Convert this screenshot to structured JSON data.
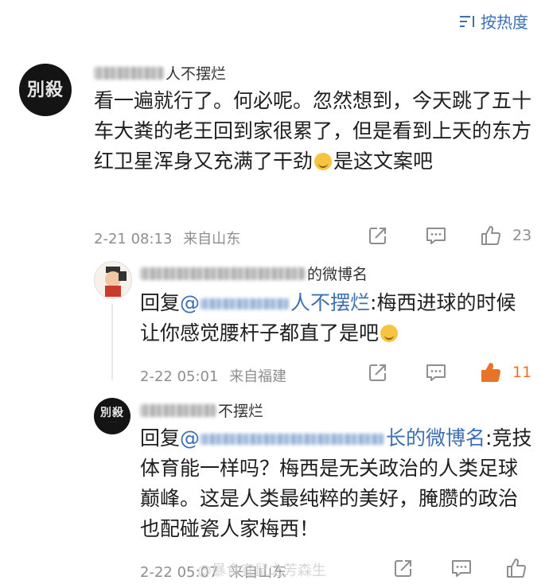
{
  "sort": {
    "label": "按热度",
    "icon": "sort-icon"
  },
  "comments": [
    {
      "avatar_text": "別殺",
      "name_suffix": "人不摆烂",
      "body": "看一遍就行了。何必呢。忽然想到，今天跳了五十车大粪的老王回到家很累了，但是看到上天的东方红卫星浑身又充满了干劲",
      "body_tail": "是这文案吧",
      "time": "2-21 08:13",
      "location": "来自山东",
      "likes": "23"
    },
    {
      "name_suffix": "的微博名",
      "reply_prefix": "回复",
      "mention": "@",
      "mention_suffix": "人不摆烂",
      "body": ":梅西进球的时候让你感觉腰杆子都直了是吧",
      "time": "2-22 05:01",
      "location": "来自福建",
      "likes": "11",
      "like_color": "#e8742a"
    },
    {
      "avatar_text": "別殺",
      "name_suffix": "不摆烂",
      "reply_prefix": "回复",
      "mention": "@",
      "mention_suffix": "长的微博名",
      "body": ":竞技体育能一样吗？梅西是无关政治的人类足球巅峰。这是人类最纯粹的美好，腌臜的政治也配碰瓷人家梅西！",
      "time": "2-22 05:07",
      "location": "来自山东"
    }
  ],
  "watermark": "@暴食宜鼠之芳森生"
}
